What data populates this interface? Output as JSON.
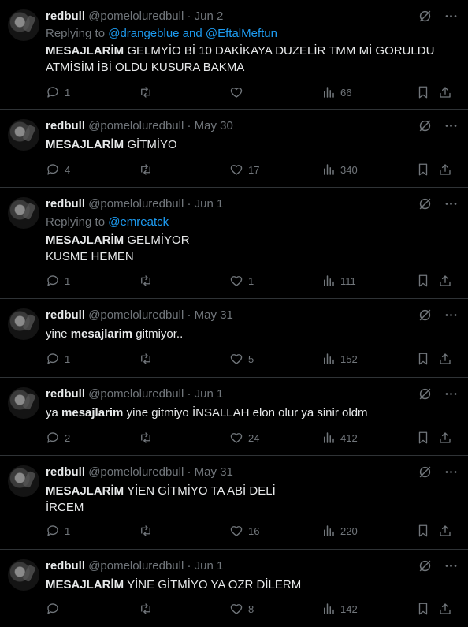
{
  "tweets": [
    {
      "name": "redbull",
      "handle": "@pomeloluredbull",
      "date": "Jun 2",
      "replying_label": "Replying to ",
      "replying_to": "@drangeblue and @EftalMeftun",
      "text_bold": "MESAJLARİM",
      "text_rest": " GELMYİO Bİ 10 DAKİKAYA DUZELİR TMM Mİ GORULDU\nATMİSİM İBİ OLDU KUSURA BAKMA",
      "replies": "1",
      "retweets": "",
      "likes": "",
      "views": "66"
    },
    {
      "name": "redbull",
      "handle": "@pomeloluredbull",
      "date": "May 30",
      "text_bold": "MESAJLARİM",
      "text_rest": " GİTMİYO",
      "replies": "4",
      "retweets": "",
      "likes": "17",
      "views": "340"
    },
    {
      "name": "redbull",
      "handle": "@pomeloluredbull",
      "date": "Jun 1",
      "replying_label": "Replying to ",
      "replying_to": "@emreatck",
      "text_bold": "MESAJLARİM",
      "text_rest": " GELMİYOR\nKUSME HEMEN",
      "replies": "1",
      "retweets": "",
      "likes": "1",
      "views": "111"
    },
    {
      "name": "redbull",
      "handle": "@pomeloluredbull",
      "date": "May 31",
      "text_pre": "yine ",
      "text_bold": "mesajlarim",
      "text_rest": " gitmiyor..",
      "replies": "1",
      "retweets": "",
      "likes": "5",
      "views": "152"
    },
    {
      "name": "redbull",
      "handle": "@pomeloluredbull",
      "date": "Jun 1",
      "text_pre": "ya ",
      "text_bold": "mesajlarim",
      "text_rest": " yine gitmiyo İNSALLAH elon olur ya sinir oldm",
      "replies": "2",
      "retweets": "",
      "likes": "24",
      "views": "412"
    },
    {
      "name": "redbull",
      "handle": "@pomeloluredbull",
      "date": "May 31",
      "text_bold": "MESAJLARİM",
      "text_rest": " YİEN GİTMİYO TA ABİ DELİ\nİRCEM",
      "replies": "1",
      "retweets": "",
      "likes": "16",
      "views": "220"
    },
    {
      "name": "redbull",
      "handle": "@pomeloluredbull",
      "date": "Jun 1",
      "text_bold": "MESAJLARİM",
      "text_rest": " YİNE GİTMİYO YA OZR DİLERM",
      "replies": "",
      "retweets": "",
      "likes": "8",
      "views": "142"
    }
  ],
  "separator": " · ",
  "icons": {
    "grok": "grok-icon",
    "more": "more-icon",
    "reply": "reply-icon",
    "retweet": "retweet-icon",
    "like": "like-icon",
    "views": "views-icon",
    "bookmark": "bookmark-icon",
    "share": "share-icon"
  },
  "colors": {
    "background": "#000000",
    "text": "#e7e9ea",
    "muted": "#71767b",
    "link": "#1d9bf0",
    "divider": "#2f3336"
  }
}
